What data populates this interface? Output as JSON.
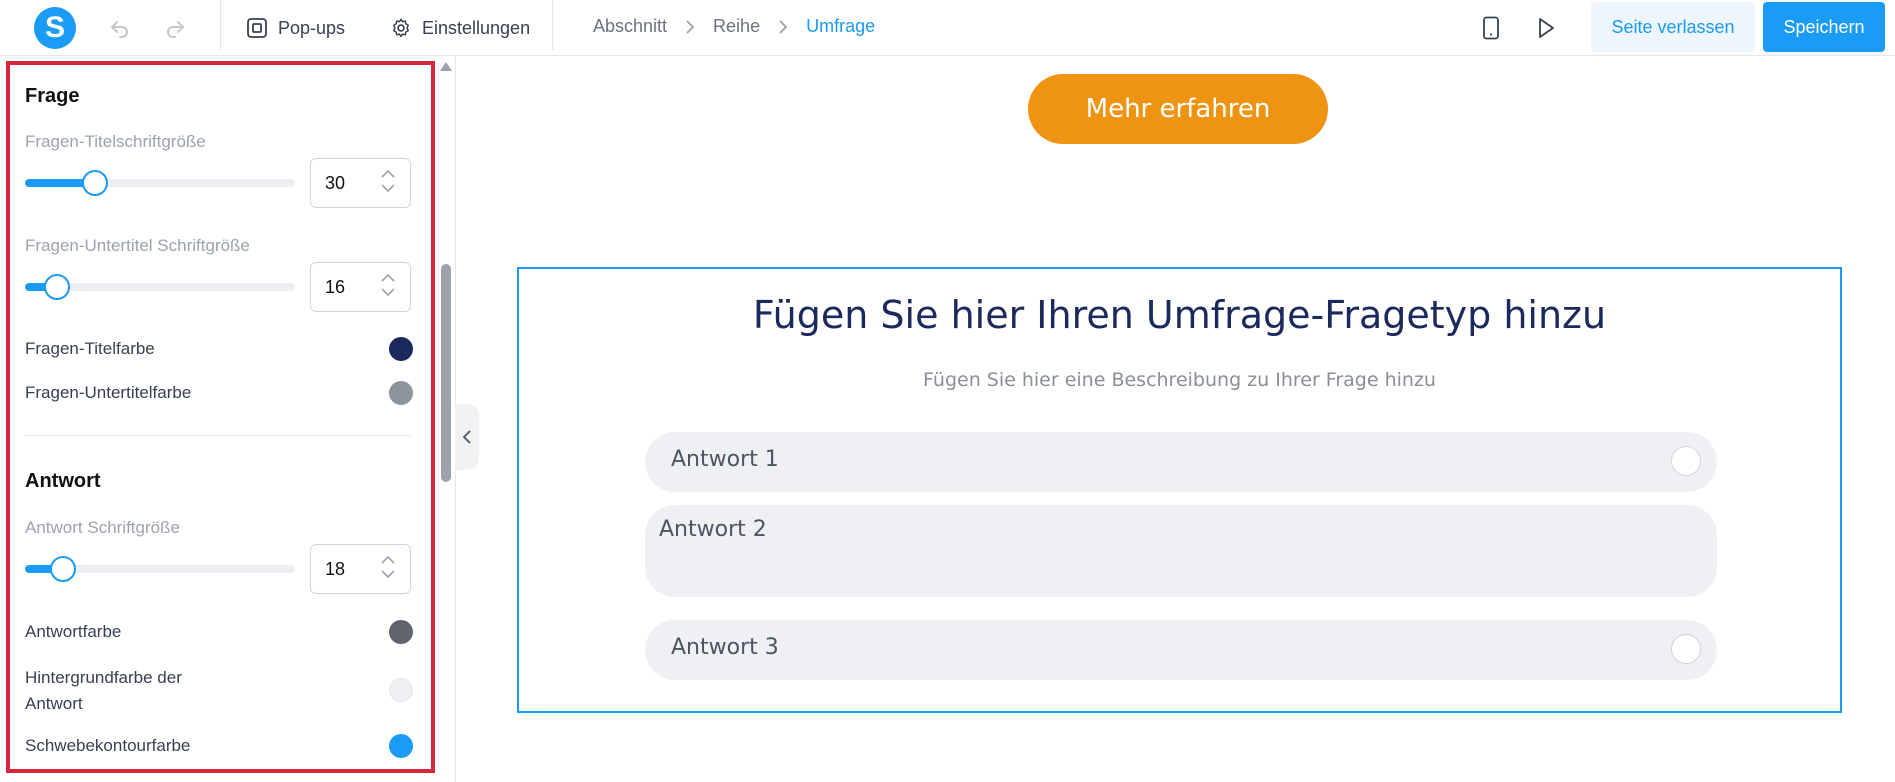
{
  "app": {
    "logo_letter": "S",
    "brand_color": "#1a9bf5"
  },
  "toolbar": {
    "popups_label": "Pop-ups",
    "settings_label": "Einstellungen",
    "leave_label": "Seite verlassen",
    "save_label": "Speichern"
  },
  "breadcrumb": [
    "Abschnitt",
    "Reihe",
    "Umfrage"
  ],
  "panel": {
    "question": {
      "title": "Frage",
      "title_size_label": "Fragen-Titelschriftgröße",
      "title_size_value": "30",
      "title_size_fraction": 0.26,
      "subtitle_size_label": "Fragen-Untertitel Schriftgröße",
      "subtitle_size_value": "16",
      "subtitle_size_fraction": 0.12,
      "title_color_label": "Fragen-Titelfarbe",
      "title_color": "#1b2a5c",
      "subtitle_color_label": "Fragen-Untertitelfarbe",
      "subtitle_color": "#8e949c"
    },
    "answer": {
      "title": "Antwort",
      "font_size_label": "Antwort Schriftgröße",
      "font_size_value": "18",
      "font_size_fraction": 0.14,
      "color_label": "Antwortfarbe",
      "color": "#5f636b",
      "bg_color_label": "Hintergrundfarbe der Antwort",
      "bg_color": "#eef0f4",
      "hover_color_label": "Schwebekontourfarbe",
      "hover_color": "#1a9bf5"
    }
  },
  "canvas": {
    "cta_label": "Mehr erfahren",
    "cta_color": "#ef9412",
    "survey": {
      "title": "Fügen Sie hier Ihren Umfrage-Fragetyp hinzu",
      "subtitle": "Fügen Sie hier eine Beschreibung zu Ihrer Frage hinzu",
      "answers": [
        "Antwort 1",
        "Antwort 2",
        "Antwort 3"
      ]
    }
  }
}
